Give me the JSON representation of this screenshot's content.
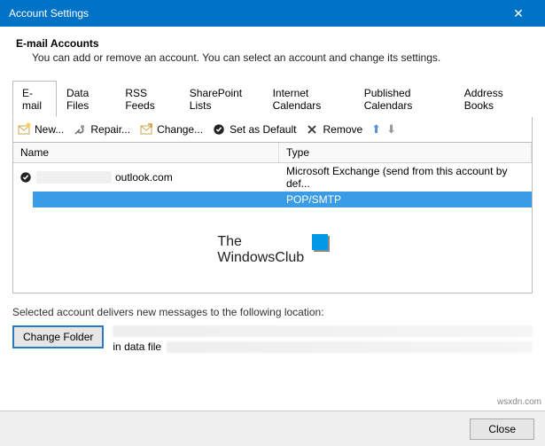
{
  "window": {
    "title": "Account Settings"
  },
  "header": {
    "title": "E-mail Accounts",
    "subtitle": "You can add or remove an account. You can select an account and change its settings."
  },
  "tabs": [
    {
      "label": "E-mail",
      "active": true
    },
    {
      "label": "Data Files"
    },
    {
      "label": "RSS Feeds"
    },
    {
      "label": "SharePoint Lists"
    },
    {
      "label": "Internet Calendars"
    },
    {
      "label": "Published Calendars"
    },
    {
      "label": "Address Books"
    }
  ],
  "toolbar": {
    "new": "New...",
    "repair": "Repair...",
    "change": "Change...",
    "set_default": "Set as Default",
    "remove": "Remove"
  },
  "list": {
    "headers": {
      "name": "Name",
      "type": "Type"
    },
    "rows": [
      {
        "name_suffix": "outlook.com",
        "type": "Microsoft Exchange (send from this account by def...",
        "default": true,
        "selected": false
      },
      {
        "name_suffix": "",
        "type": "POP/SMTP",
        "default": false,
        "selected": true
      }
    ]
  },
  "watermark": {
    "line1": "The",
    "line2": "WindowsClub"
  },
  "delivery": {
    "label": "Selected account delivers new messages to the following location:",
    "change_folder": "Change Folder",
    "in_data_file": "in data file"
  },
  "footer": {
    "close": "Close"
  },
  "attribution": "wsxdn.com"
}
